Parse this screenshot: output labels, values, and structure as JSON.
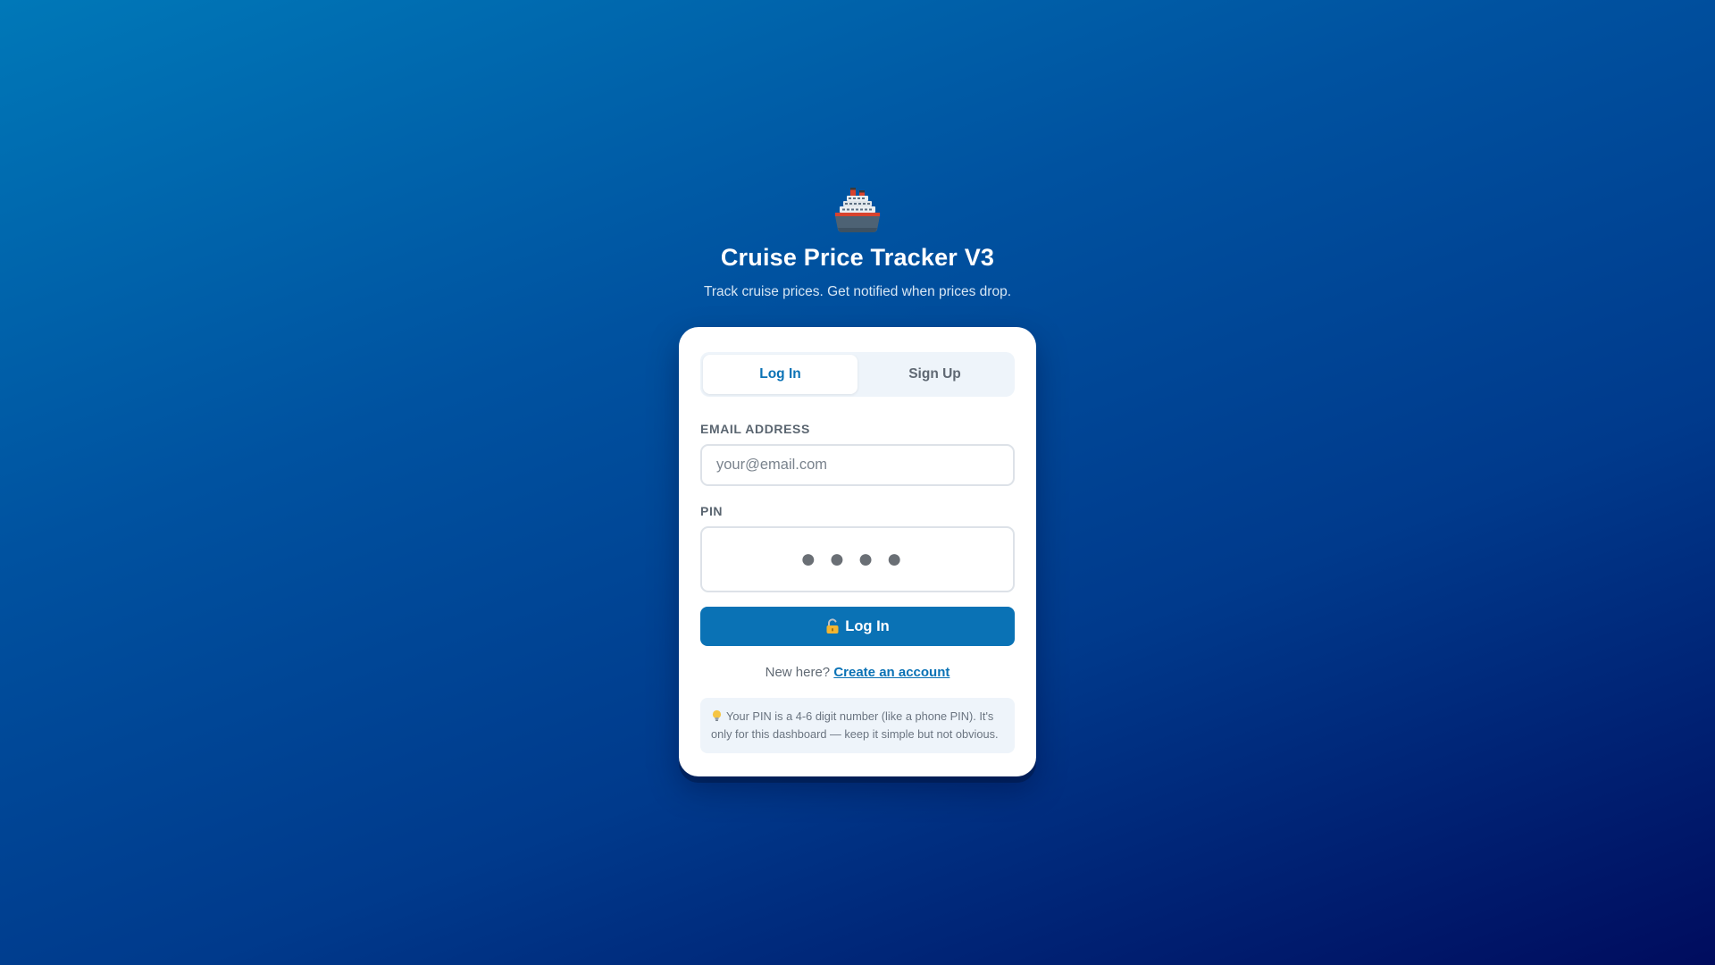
{
  "app": {
    "title": "Cruise Price Tracker V3",
    "tagline": "Track cruise prices. Get notified when prices drop.",
    "logo_icon": "cruise-ship-icon"
  },
  "auth_tabs": [
    {
      "label": "Log In",
      "active": true
    },
    {
      "label": "Sign Up",
      "active": false
    }
  ],
  "form": {
    "email_label": "EMAIL ADDRESS",
    "email_placeholder": "your@email.com",
    "email_value": "",
    "pin_label": "PIN",
    "pin_placeholder": "●●●●",
    "pin_value": "",
    "submit_label": "Log In",
    "submit_icon": "lock-icon"
  },
  "signup_prompt": {
    "text": "New here?",
    "link": "Create an account"
  },
  "tip": {
    "icon": "lightbulb-icon",
    "text": "Your PIN is a 4-6 digit number (like a phone PIN). It's only for this dashboard — keep it simple but not obvious."
  },
  "colors": {
    "accent": "#0a72b5",
    "background_start": "#0078b8",
    "background_end": "#000c5e",
    "card": "#ffffff",
    "tip_background": "#eef4fa"
  }
}
